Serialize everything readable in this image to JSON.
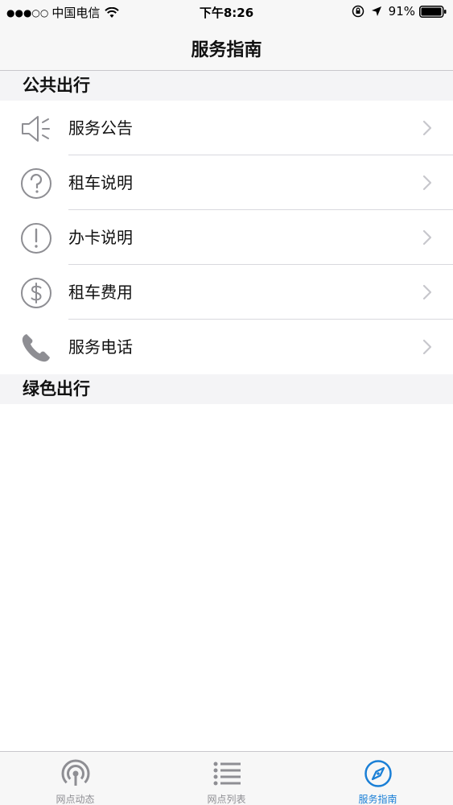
{
  "status_bar": {
    "signal": "●●●○○",
    "carrier": "中国电信",
    "time": "下午8:26",
    "battery_percent": "91%"
  },
  "nav": {
    "title": "服务指南"
  },
  "sections": [
    {
      "title": "公共出行"
    },
    {
      "title": "绿色出行"
    }
  ],
  "list_items": [
    {
      "label": "服务公告",
      "icon": "speaker-icon"
    },
    {
      "label": "租车说明",
      "icon": "question-circle-icon"
    },
    {
      "label": "办卡说明",
      "icon": "exclamation-circle-icon"
    },
    {
      "label": "租车费用",
      "icon": "dollar-circle-icon"
    },
    {
      "label": "服务电话",
      "icon": "phone-icon"
    }
  ],
  "tabs": [
    {
      "label": "网点动态",
      "icon": "broadcast-icon",
      "active": false
    },
    {
      "label": "网点列表",
      "icon": "list-icon",
      "active": false
    },
    {
      "label": "服务指南",
      "icon": "compass-icon",
      "active": true
    }
  ],
  "colors": {
    "accent": "#1a7fd6",
    "icon_gray": "#8e8e93",
    "chevron": "#c7c7cc"
  }
}
